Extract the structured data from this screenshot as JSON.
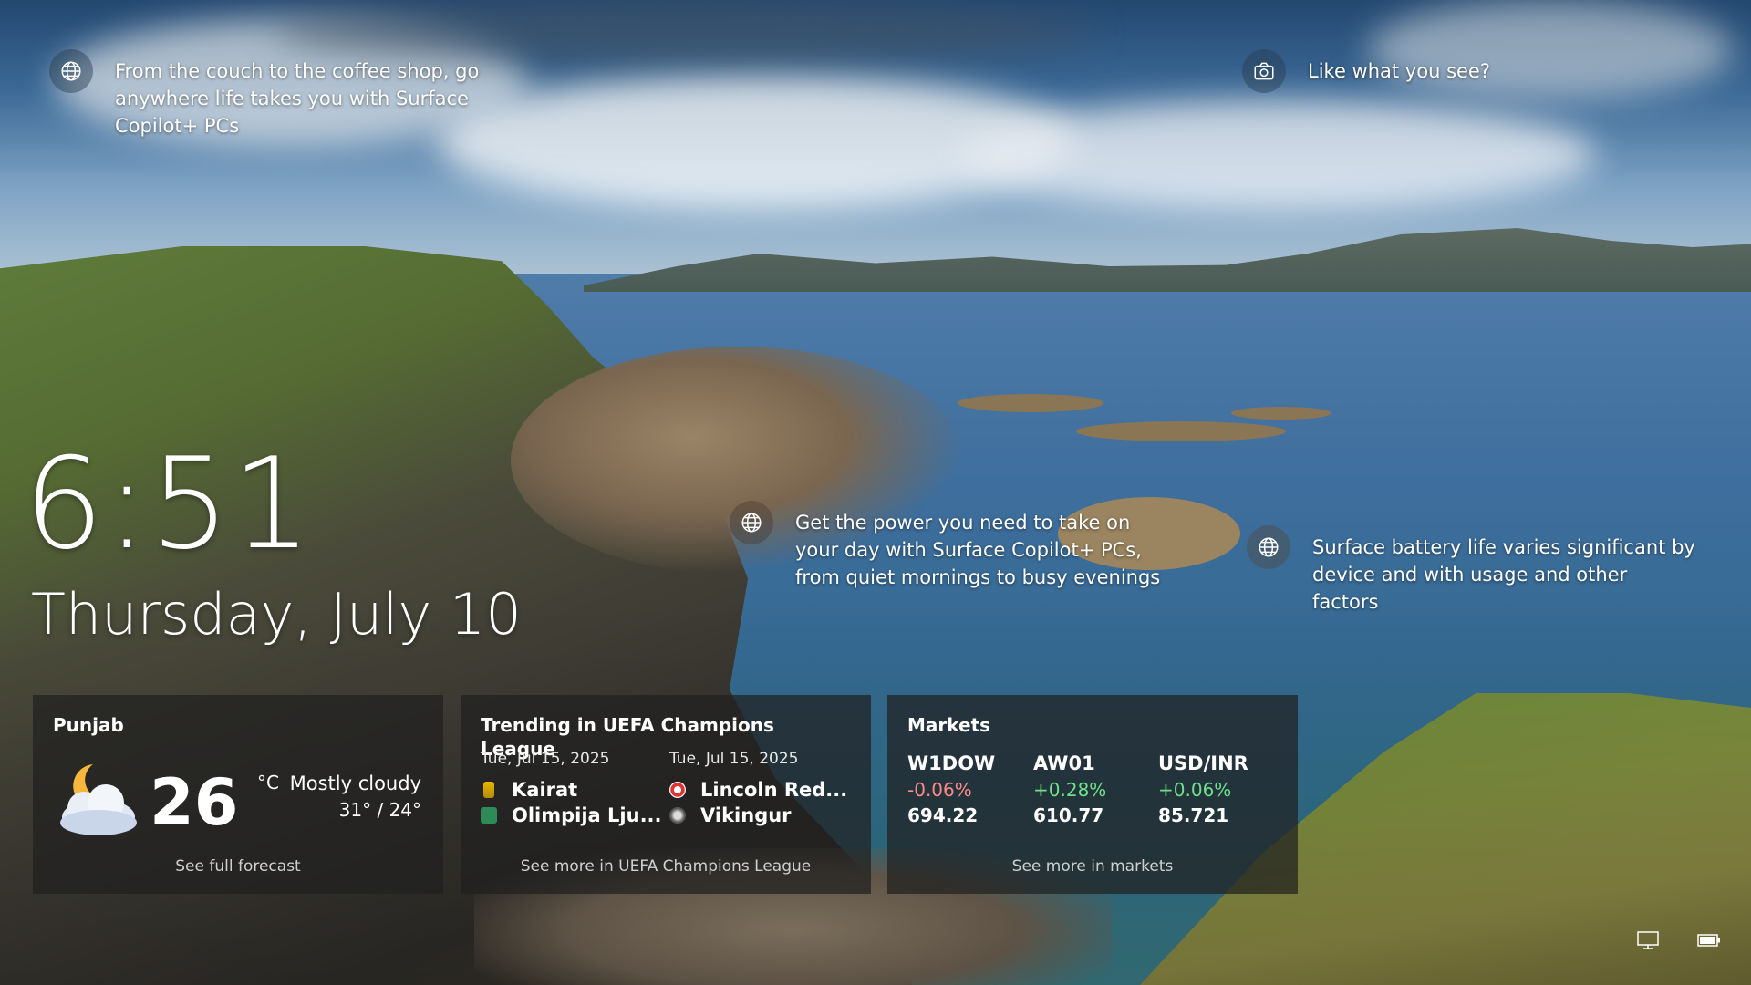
{
  "tips": {
    "promo_1": "From the couch to the coffee shop, go anywhere life takes you with Surface Copilot+ PCs",
    "like": "Like what you see?",
    "promo_2": "Get the power you need to take on your day with Surface Copilot+ PCs, from quiet mornings to busy evenings",
    "promo_3": "Surface battery life varies significant by device and with usage and other factors"
  },
  "clock": {
    "time": "6:51",
    "date": "Thursday, July 10"
  },
  "weather": {
    "location": "Punjab",
    "temperature": "26",
    "unit": "°C",
    "condition": "Mostly cloudy",
    "high_low": "31° / 24°",
    "footer": "See full forecast",
    "icon": "moon-cloud-icon"
  },
  "sports": {
    "title": "Trending in UEFA Champions League",
    "matches": [
      {
        "date": "Tue, Jul 15, 2025",
        "team1": "Kairat",
        "team2": "Olimpija Lju..."
      },
      {
        "date": "Tue, Jul 15, 2025",
        "team1": "Lincoln Red...",
        "team2": "Vikingur"
      }
    ],
    "footer": "See more in UEFA Champions League"
  },
  "markets": {
    "title": "Markets",
    "tickers": [
      {
        "symbol": "W1DOW",
        "change": "-0.06%",
        "value": "694.22",
        "direction": "down"
      },
      {
        "symbol": "AW01",
        "change": "+0.28%",
        "value": "610.77",
        "direction": "up"
      },
      {
        "symbol": "USD/INR",
        "change": "+0.06%",
        "value": "85.721",
        "direction": "up"
      }
    ],
    "footer": "See more in markets"
  },
  "colors": {
    "negative": "#ff8a8a",
    "positive": "#6fe08a",
    "card_bg": "#202020"
  },
  "tray": [
    "network-icon",
    "battery-icon"
  ]
}
